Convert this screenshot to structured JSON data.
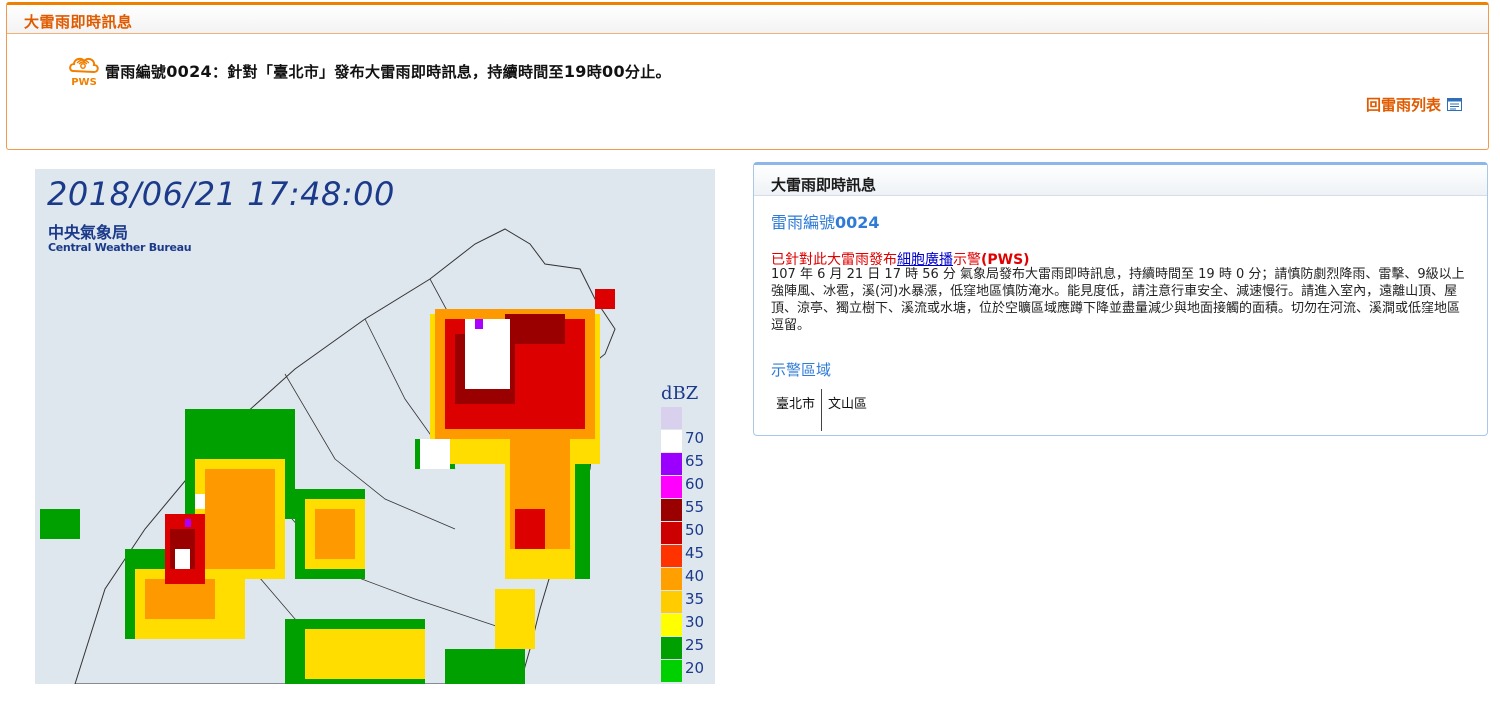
{
  "top_panel": {
    "title": "大雷雨即時訊息",
    "notice_prefix": "雷雨編號",
    "notice_number": "0024",
    "notice_mid": "：針對「臺北市」發布大雷雨即時訊息，持續時間至",
    "notice_hour": "19",
    "notice_hour_unit": "時",
    "notice_min": "00",
    "notice_suffix": "分止。",
    "pws_label": "PWS",
    "back_link": "回雷雨列表"
  },
  "radar": {
    "timestamp": "2018/06/21 17:48:00",
    "agency_cn": "中央氣象局",
    "agency_en": "Central Weather Bureau",
    "unit": "dBZ",
    "scale_labels": [
      "70",
      "65",
      "60",
      "55",
      "50",
      "45",
      "40",
      "35",
      "30",
      "25",
      "20"
    ],
    "scale_colors": [
      "#d8d0ec",
      "#ffffff",
      "#9b00ff",
      "#ff00ff",
      "#9a0000",
      "#cc0000",
      "#ff3300",
      "#ffa000",
      "#ffcc00",
      "#ffff00",
      "#00a000",
      "#00d000"
    ]
  },
  "info_panel": {
    "title": "大雷雨即時訊息",
    "number_prefix": "雷雨編號",
    "number": "0024",
    "warn_prefix": "已針對此大雷雨發布",
    "warn_link": "細胞廣播",
    "warn_mid": "示警",
    "warn_pws": "(PWS)",
    "body": "107 年 6 月 21 日 17 時 56 分 氣象局發布大雷雨即時訊息，持續時間至 19 時 0 分；請慎防劇烈降雨、雷擊、9級以上強陣風、冰雹，溪(河)水暴漲，低窪地區慎防淹水。能見度低，請注意行車安全、減速慢行。請進入室內，遠離山頂、屋頂、涼亭、獨立樹下、溪流或水塘，位於空曠區域應蹲下降並盡量減少與地面接觸的面積。切勿在河流、溪澗或低窪地區逗留。",
    "zone_title": "示警區域",
    "zone_city": "臺北市",
    "zone_district": "文山區"
  }
}
